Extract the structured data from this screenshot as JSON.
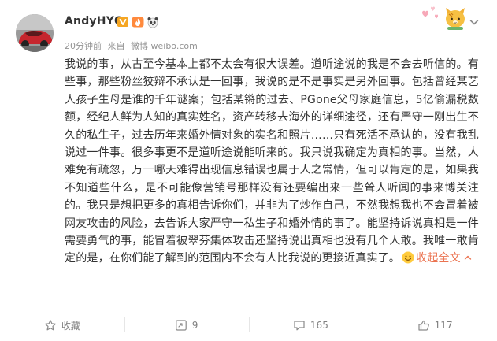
{
  "user": {
    "name": "AndyHYQ",
    "badges": [
      "verified-v-icon",
      "flame-badge-icon",
      "panda-emoji-icon"
    ]
  },
  "meta": {
    "time": "20分钟前",
    "source_prefix": "来自",
    "source": "微博 weibo.com"
  },
  "post": {
    "text": "我说的事，从古至今基本上都不太会有很大误差。道听途说的我是不会去听信的。有些事，那些粉丝狡辩不承认是一回事，我说的是不是事实是另外回事。包括曾经某艺人孩子生母是谁的千年谜案；包括某锵的过去、PGone父母家庭信息，5亿偷漏税数额，经纪人鲜为人知的真实姓名，资产转移去海外的详细途径，还有严守一刚出生不久的私生子，过去历年来婚外情对象的实名和照片……只有死活不承认的，没有我乱说过一件事。很多事更不是道听途说能听来的。我只说我确定为真相的事。当然，人难免有疏忽，万一哪天难得出现信息错误也属于人之常情，但可以肯定的是，如果我不知道些什么，是不可能像营销号那样没有还要编出来一些耸人听闻的事来博关注的。我只是想把更多的真相告诉你们，并非为了炒作自己，不然我想我也不会冒着被网友攻击的风险，去告诉大家严守一私生子和婚外情的事了。能坚持诉说真相是一件需要勇气的事，能冒着被翠芬集体攻击还坚持说出真相也没有几个人敢。我唯一敢肯定的是，在你们能了解到的范围内不会有人比我说的更接近真实了。",
    "emoji": "smile-emoji-icon",
    "collapse_label": "收起全文"
  },
  "footer": {
    "favorite_label": "收藏",
    "repost_count": "9",
    "comment_count": "165",
    "like_count": "117"
  },
  "colors": {
    "link": "#eb7350",
    "text": "#333333",
    "muted": "#939393",
    "footer_text": "#808080"
  }
}
